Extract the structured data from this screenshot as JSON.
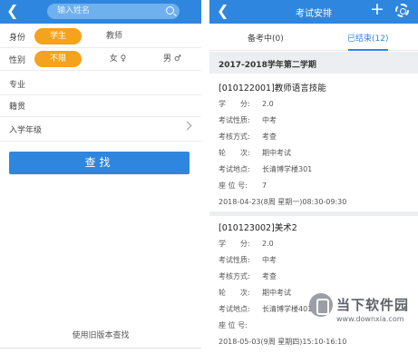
{
  "left": {
    "search_placeholder": "输入姓名",
    "identity": {
      "label": "身份",
      "options": [
        "学生",
        "教师"
      ],
      "selected": "学生"
    },
    "gender": {
      "label": "性别",
      "options": [
        "不限",
        "女",
        "男"
      ],
      "female_icon": "female-symbol",
      "male_icon": "male-symbol",
      "selected": "不限"
    },
    "major_label": "专业",
    "origin_label": "籍贯",
    "year_label": "入学年级",
    "query_button": "查找",
    "old_version_link": "使用旧版本查找"
  },
  "right": {
    "title": "考试安排",
    "tabs": [
      "备考中(0)",
      "已结束(12)"
    ],
    "active_tab": "已结束(12)",
    "term": "2017-2018学年第二学期",
    "exams": [
      {
        "title": "[010122001]教师语言技能",
        "fields": [
          {
            "k": "学　　分:",
            "v": "2.0"
          },
          {
            "k": "考试性质:",
            "v": "中考"
          },
          {
            "k": "考核方式:",
            "v": "考查"
          },
          {
            "k": "轮　　次:",
            "v": "期中考试"
          },
          {
            "k": "考试地点:",
            "v": "长清博学楼301"
          },
          {
            "k": "座 位 号:",
            "v": "7"
          }
        ],
        "time": "2018-04-23(8周 星期一)08:30-09:30"
      },
      {
        "title": "[010123002]美术2",
        "fields": [
          {
            "k": "学　　分:",
            "v": "2.0"
          },
          {
            "k": "考试性质:",
            "v": "中考"
          },
          {
            "k": "考核方式:",
            "v": "考查"
          },
          {
            "k": "轮　　次:",
            "v": "期中考试"
          },
          {
            "k": "考试地点:",
            "v": "长清博学楼401"
          },
          {
            "k": "座 位 号:",
            "v": ""
          }
        ],
        "time": "2018-05-03(9周 星期四)15:10-16:10"
      }
    ]
  },
  "watermark": {
    "text": "当下软件园",
    "url": "www.downxia.com"
  },
  "colors": {
    "primary": "#2f86df",
    "accent": "#f5a21c"
  }
}
